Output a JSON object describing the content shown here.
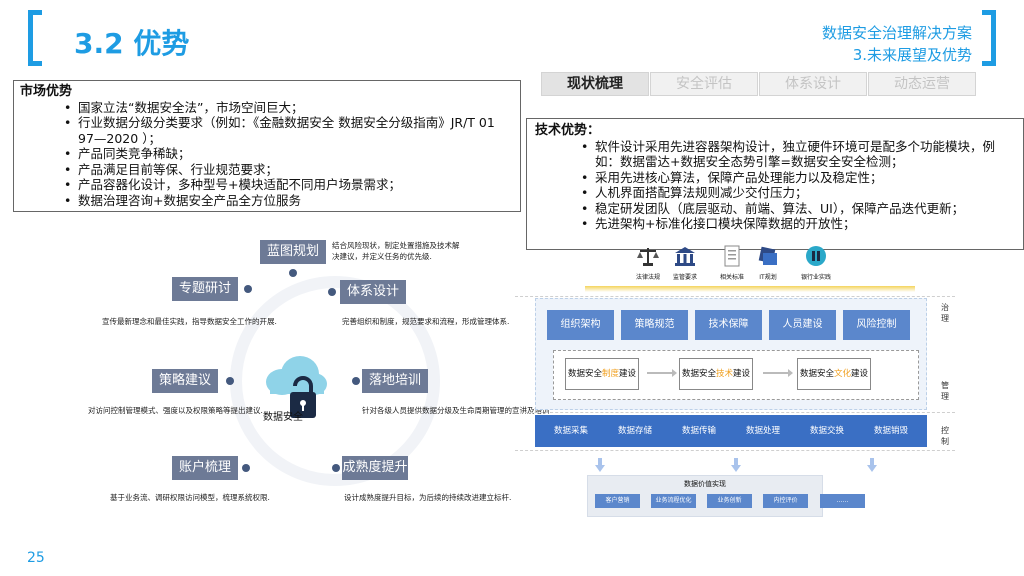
{
  "header": {
    "title": "3.2 优势",
    "subtitle_line1": "数据安全治理解决方案",
    "subtitle_line2": "3.未来展望及优势"
  },
  "tabs": [
    {
      "label": "现状梳理",
      "active": true
    },
    {
      "label": "安全评估",
      "active": false
    },
    {
      "label": "体系设计",
      "active": false
    },
    {
      "label": "动态运营",
      "active": false
    }
  ],
  "market": {
    "title": "市场优势",
    "items": [
      "国家立法“数据安全法”，市场空间巨大；",
      "行业数据分级分类要求（例如：《金融数据安全 数据安全分级指南》JR/T 01 97—2020 ）；",
      "产品同类竞争稀缺；",
      "产品满足目前等保、行业规范要求；",
      "产品容器化设计，多种型号+模块适配不同用户场景需求；",
      "数据治理咨询+数据安全产品全方位服务"
    ]
  },
  "tech": {
    "title": "技术优势：",
    "items": [
      "软件设计采用先进容器架构设计，独立硬件环境可是配多个功能模块，例如：数据雷达+数据安全态势引擎=数据安全安全检测；",
      "采用先进核心算法，保障产品处理能力以及稳定性；",
      "人机界面搭配算法规则减少交付压力；",
      "稳定研发团队（底层驱动、前端、算法、UI），保障产品迭代更新；",
      "先进架构+标准化接口模块保障数据的开放性；"
    ]
  },
  "diagram": {
    "center_label": "数据安全",
    "nodes": {
      "blueprint": {
        "label": "蓝图规划",
        "note": "结合风险现状，制定处置措施及技术解决建议，并定义任务的优先级."
      },
      "system": {
        "label": "体系设计",
        "note": "完善组织和制度，规范要求和流程，形成管理体系."
      },
      "landing": {
        "label": "落地培训",
        "note": "针对各级人员提供数据分级及生命周期管理的宣讲及培训."
      },
      "maturity": {
        "label": "成熟度提升",
        "note": "设计成熟度提升目标，为后续的持续改进建立标杆."
      },
      "account": {
        "label": "账户梳理",
        "note": "基于业务流、调研权限访问模型，梳理系统权限."
      },
      "strategy": {
        "label": "策略建议",
        "note": "对访问控制管理模式、强度以及权限策略等提出建议."
      },
      "research": {
        "label": "专题研讨",
        "note": "宣传最新理念和最佳实践，指导数据安全工作的开展."
      }
    }
  },
  "framework": {
    "icons": [
      {
        "label": "法律法规",
        "icon": "scales-icon"
      },
      {
        "label": "监管要求",
        "icon": "government-icon"
      },
      {
        "label": "相关标准",
        "icon": "document-icon"
      },
      {
        "label": "IT规划",
        "icon": "server-icon"
      },
      {
        "label": "银行业实践",
        "icon": "bank-practice-icon"
      }
    ],
    "governance_items": [
      "组织架构",
      "策略规范",
      "技术保障",
      "人员建设",
      "风险控制"
    ],
    "build_items": [
      {
        "pre": "数据安全",
        "hl": "制度",
        "post": "建设"
      },
      {
        "pre": "数据安全",
        "hl": "技术",
        "post": "建设"
      },
      {
        "pre": "数据安全",
        "hl": "文化",
        "post": "建设"
      }
    ],
    "control_items": [
      "数据采集",
      "数据存储",
      "数据传输",
      "数据处理",
      "数据交换",
      "数据销毁"
    ],
    "value_title": "数据价值实现",
    "value_items": [
      "客户营销",
      "业务流程优化",
      "业务创新",
      "内控评价",
      "……"
    ],
    "side_labels": [
      "治理",
      "管理",
      "控制"
    ],
    "colors": {
      "primary_blue": "#5b87cc",
      "control_blue": "#3a6fc4",
      "accent": "#f0a020"
    }
  },
  "page_number": "25",
  "theme": {
    "accent": "#1e9ce3",
    "node_gray": "#6d7a96"
  }
}
